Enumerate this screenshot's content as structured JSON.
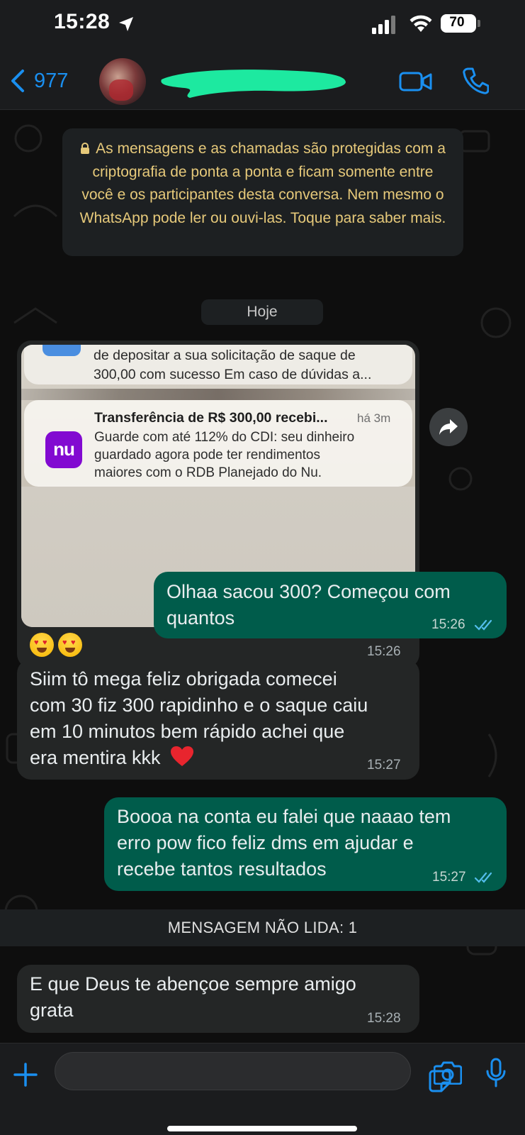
{
  "status_bar": {
    "time": "15:28",
    "battery": "70"
  },
  "header": {
    "back_count": "977"
  },
  "encryption_notice": "As mensagens e as chamadas são protegidas com a criptografia de ponta a ponta e ficam somente entre você e os participantes desta conversa. Nem mesmo o WhatsApp pode ler ou ouvi-las. Toque para saber mais.",
  "date_divider": "Hoje",
  "image_message": {
    "notif_top_line1": "de depositar a sua solicitação de saque de",
    "notif_top_line2": "300,00 com sucesso Em caso de dúvidas a...",
    "notif_app_icon": "nu",
    "notif_title": "Transferência de R$ 300,00 recebi...",
    "notif_time": "há 3m",
    "notif_body_line1": "Guarde com até 112% do CDI: seu dinheiro",
    "notif_body_line2": "guardado agora pode ter rendimentos",
    "notif_body_line3": "maiores com o RDB Planejado do Nu.",
    "time": "15:26"
  },
  "messages": [
    {
      "direction": "out",
      "line1": "Olhaa sacou 300? Começou com",
      "line2": "quantos",
      "time": "15:26"
    },
    {
      "direction": "in",
      "line1": "Siim tô mega feliz obrigada comecei",
      "line2": "com 30 fiz 300 rapidinho e o saque caiu",
      "line3": "em 10 minutos bem rápido achei que",
      "line4": "era mentira kkk",
      "time": "15:27"
    },
    {
      "direction": "out",
      "line1": "Boooa na conta eu falei que naaao tem",
      "line2": "erro pow fico feliz dms em ajudar e",
      "line3": "recebe tantos resultados",
      "time": "15:27"
    },
    {
      "direction": "in",
      "line1": "E que Deus te abençoe sempre amigo",
      "line2": "grata",
      "time": "15:28"
    }
  ],
  "unread_divider": "MENSAGEM NÃO LIDA: 1",
  "colors": {
    "accent_blue": "#1a8ff0",
    "outgoing_bubble": "#005c4b",
    "incoming_bubble": "#242626",
    "read_ticks": "#53bdeb",
    "redaction": "#1de9a0",
    "notice_text": "#e6c97a"
  },
  "icons": [
    "location-arrow-icon",
    "cellular-signal-icon",
    "wifi-icon",
    "chevron-left-icon",
    "video-call-icon",
    "phone-icon",
    "lock-icon",
    "forward-icon",
    "heart-icon",
    "plus-icon",
    "sticker-icon",
    "camera-icon",
    "microphone-icon"
  ]
}
